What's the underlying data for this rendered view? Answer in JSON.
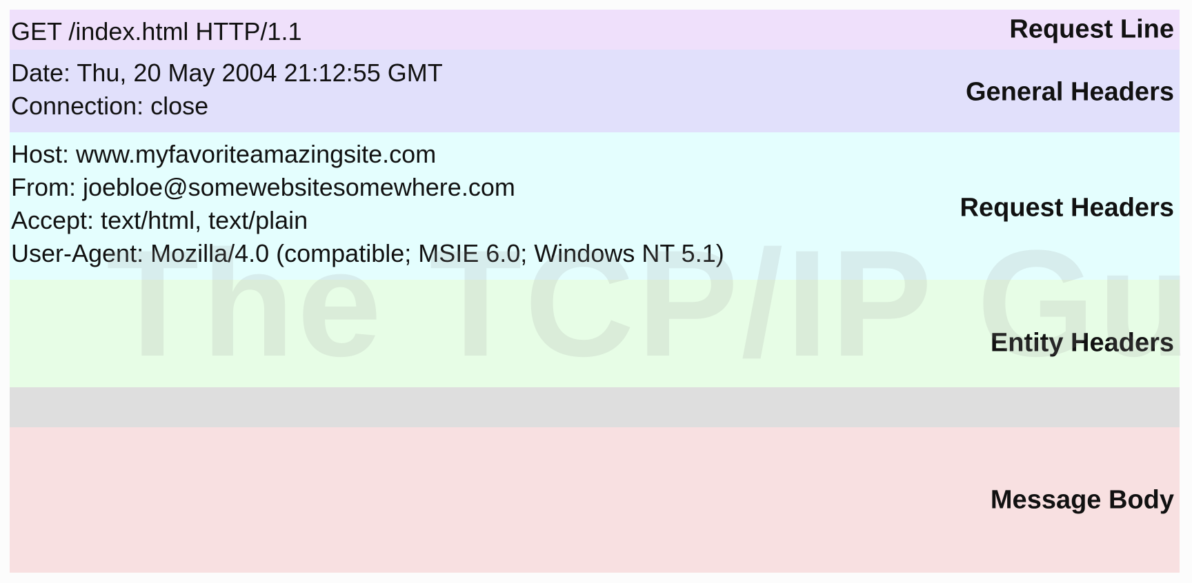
{
  "colors": {
    "request_line": "#efe0fb",
    "general_headers": "#e1e0fb",
    "request_headers": "#e4fefe",
    "entity_headers": "#e7fde6",
    "separator": "#dedede",
    "message_body": "#f8e0e1"
  },
  "request_line": {
    "label": "Request Line",
    "lines": [
      "GET /index.html HTTP/1.1"
    ]
  },
  "general_headers": {
    "label": "General Headers",
    "lines": [
      "Date: Thu, 20 May 2004 21:12:55 GMT",
      "Connection: close"
    ]
  },
  "request_headers": {
    "label": "Request Headers",
    "lines": [
      "Host: www.myfavoriteamazingsite.com",
      "From: joebloe@somewebsitesomewhere.com",
      "Accept: text/html, text/plain",
      "User-Agent: Mozilla/4.0 (compatible; MSIE 6.0; Windows NT 5.1)"
    ]
  },
  "entity_headers": {
    "label": "Entity Headers",
    "lines": []
  },
  "message_body": {
    "label": "Message Body",
    "lines": []
  },
  "watermark": "The TCP/IP Guide"
}
